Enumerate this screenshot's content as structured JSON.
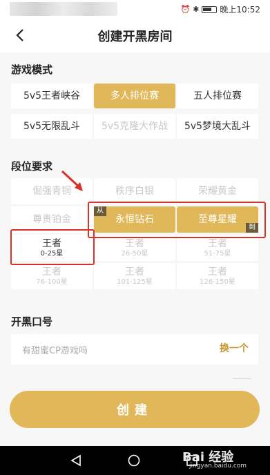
{
  "status_bar": {
    "icons": [
      "alarm-icon",
      "bluetooth-icon",
      "battery-icon"
    ],
    "time": "晚上10:52"
  },
  "header": {
    "back_icon": "chevron-left-icon",
    "title": "创建开黑房间"
  },
  "game_mode": {
    "title": "游戏模式",
    "options": [
      {
        "label": "5v5王者峡谷",
        "state": "normal"
      },
      {
        "label": "多人排位赛",
        "state": "selected"
      },
      {
        "label": "五人排位赛",
        "state": "normal"
      },
      {
        "label": "5v5无限乱斗",
        "state": "normal"
      },
      {
        "label": "5v5克隆大作战",
        "state": "disabled"
      },
      {
        "label": "5v5梦境大乱斗",
        "state": "normal"
      }
    ]
  },
  "rank_requirement": {
    "title": "段位要求",
    "tag_from": "从",
    "tag_to": "到",
    "options": [
      {
        "label": "倔强青铜",
        "sub": "",
        "state": "disabled"
      },
      {
        "label": "秩序白银",
        "sub": "",
        "state": "disabled"
      },
      {
        "label": "荣耀黄金",
        "sub": "",
        "state": "disabled"
      },
      {
        "label": "尊贵铂金",
        "sub": "",
        "state": "disabled"
      },
      {
        "label": "永恒钻石",
        "sub": "",
        "state": "selected"
      },
      {
        "label": "至尊星耀",
        "sub": "",
        "state": "selected"
      },
      {
        "label": "王者",
        "sub": "0-25星",
        "state": "normal"
      },
      {
        "label": "王者",
        "sub": "26-50星",
        "state": "disabled"
      },
      {
        "label": "王者",
        "sub": "51-75星",
        "state": "disabled"
      },
      {
        "label": "王者",
        "sub": "76-100星",
        "state": "disabled"
      },
      {
        "label": "王者",
        "sub": "101-125星",
        "state": "disabled"
      },
      {
        "label": "王者",
        "sub": "126-150星",
        "state": "disabled"
      }
    ]
  },
  "slogan": {
    "title": "开黑口号",
    "placeholder": "有甜蜜CP游戏吗",
    "swap_label": "换一个"
  },
  "create_button": {
    "label": "创建"
  },
  "nav_bar": {
    "icons": [
      "back-triangle-icon",
      "home-circle-icon",
      "recents-square-icon"
    ]
  },
  "watermark": {
    "brand": "Bai 经验",
    "url": "jingyan.baidu.com"
  },
  "colors": {
    "accent": "#e0b85a",
    "annotation": "#d9302a",
    "tag": "#6b5a3a",
    "swap_text": "#c8962c"
  }
}
